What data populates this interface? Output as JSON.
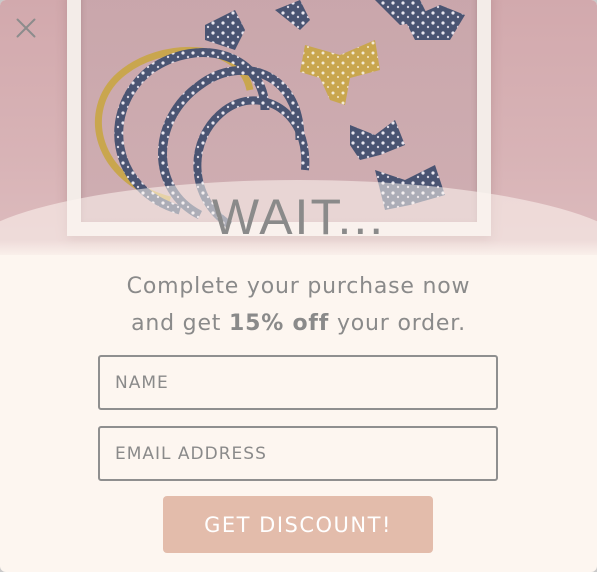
{
  "popup": {
    "close_label": "×",
    "headline": "WAIT...",
    "subtext_before": "Complete your purchase now",
    "subtext_and_get": "and get ",
    "subtext_discount": "15% off",
    "subtext_after": " your order.",
    "name_placeholder": "NAME",
    "email_placeholder": "EMAIL ADDRESS",
    "submit_label": "GET DISCOUNT!"
  },
  "colors": {
    "background": "#fdf6f0",
    "text": "#8a8a8a",
    "button": "#e3bcab",
    "hero": "#d2a9ad"
  },
  "icons": {
    "close": "close-icon"
  }
}
